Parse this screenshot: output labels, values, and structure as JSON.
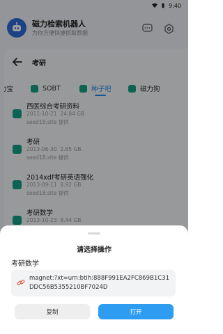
{
  "status_bar": {
    "time": "9:40"
  },
  "app": {
    "title": "磁力检索机器人",
    "subtitle": "为你方便快捷抓取数据"
  },
  "page": {
    "title": "考研"
  },
  "tabs": [
    {
      "label": "力宝"
    },
    {
      "label": "SOBT"
    },
    {
      "label": "种子吧",
      "active": true
    },
    {
      "label": "磁力狗"
    }
  ],
  "results": [
    {
      "title": "西医综合考研资料",
      "date": "2011-10-21",
      "size": "24.84 GB",
      "source": "seed18.site 提供"
    },
    {
      "title": "考研",
      "date": "2013-06-30",
      "size": "2.85 GB",
      "source": "seed18.site 提供"
    },
    {
      "title": "2014xdf考研英语强化",
      "date": "2013-09-11",
      "size": "8.92 GB",
      "source": "seed18.site 提供"
    },
    {
      "title": "考研数学",
      "date": "2013-10-23",
      "size": "8.44 GB",
      "source": ""
    }
  ],
  "sheet": {
    "title": "请选择操作",
    "item_name": "考研数学",
    "magnet": "magnet:?xt=urn:btih:888F991EA2FC869B1C31DDC56B5355210BF7024D",
    "copy_label": "复制",
    "open_label": "打开"
  },
  "colors": {
    "accent": "#1e88e5",
    "primary_button": "#2e9cf0",
    "icon_green": "#16a085",
    "avatar_blue": "#2e6bd8"
  },
  "icons": {
    "back": "arrow-left-icon",
    "chat": "chat-bubble-icon",
    "settings": "settings-icon",
    "link": "link-icon",
    "robot": "robot-icon"
  }
}
